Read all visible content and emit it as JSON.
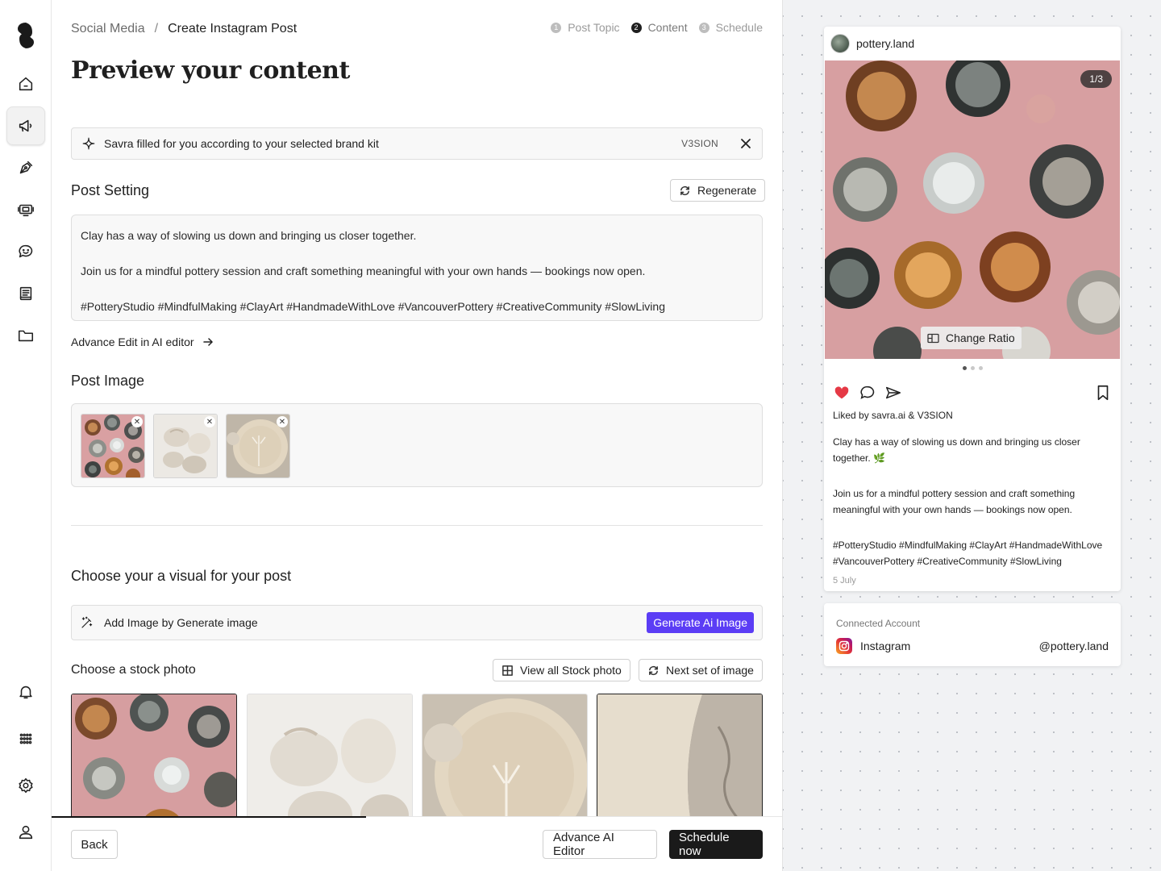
{
  "breadcrumb": {
    "parent": "Social Media",
    "separator": "/",
    "current": "Create Instagram Post"
  },
  "steps": [
    {
      "num": "1",
      "label": "Post Topic",
      "active": false
    },
    {
      "num": "2",
      "label": "Content",
      "active": true
    },
    {
      "num": "3",
      "label": "Schedule",
      "active": false
    }
  ],
  "page_title": "Preview your content",
  "banner": {
    "text": "Savra filled for you according to your selected brand kit",
    "brand": "V3SION"
  },
  "post_setting": {
    "title": "Post Setting",
    "regenerate_label": "Regenerate",
    "caption": [
      "Clay has a way of slowing us down and bringing us closer together.",
      "Join us for a mindful pottery session and craft something meaningful with your own hands — bookings now open.",
      "#PotteryStudio #MindfulMaking #ClayArt #HandmadeWithLove #VancouverPottery #CreativeCommunity #SlowLiving"
    ],
    "advance_edit_label": "Advance Edit in AI editor"
  },
  "post_image": {
    "title": "Post Image",
    "thumbs": [
      "bowls",
      "cups",
      "plate"
    ]
  },
  "visual": {
    "title": "Choose your a visual for your post",
    "generate_text": "Add Image by Generate image",
    "generate_button": "Generate Ai Image"
  },
  "stock": {
    "title": "Choose a stock photo",
    "view_all_label": "View all Stock photo",
    "next_set_label": "Next set of image"
  },
  "footer": {
    "back_label": "Back",
    "advance_label": "Advance AI Editor",
    "schedule_label": "Schedule now",
    "progress": 0.43
  },
  "preview": {
    "username": "pottery.land",
    "counter": "1/3",
    "change_ratio_label": "Change Ratio",
    "liked_by": "Liked by savra.ai & V3SION",
    "caption_line1": "Clay has a way of slowing us down and bringing us closer together. 🌿",
    "caption_line2": "Join us for a mindful pottery session and craft something meaningful with your own hands — bookings now open.",
    "caption_line3": "#PotteryStudio #MindfulMaking #ClayArt #HandmadeWithLove #VancouverPottery #CreativeCommunity #SlowLiving",
    "date": "5 July"
  },
  "connected": {
    "label": "Connected Account",
    "platform": "Instagram",
    "handle": "@pottery.land"
  },
  "sidebar": {
    "items": [
      "home-icon",
      "megaphone-icon",
      "pen-icon",
      "video-icon",
      "chat-smile-icon",
      "book-icon",
      "folder-icon"
    ],
    "bottom": [
      "bell-icon",
      "apps-icon",
      "settings-icon",
      "user-icon"
    ]
  },
  "colors": {
    "accent": "#5b3df5",
    "dark": "#1a1a1a",
    "heart": "#e53945"
  }
}
